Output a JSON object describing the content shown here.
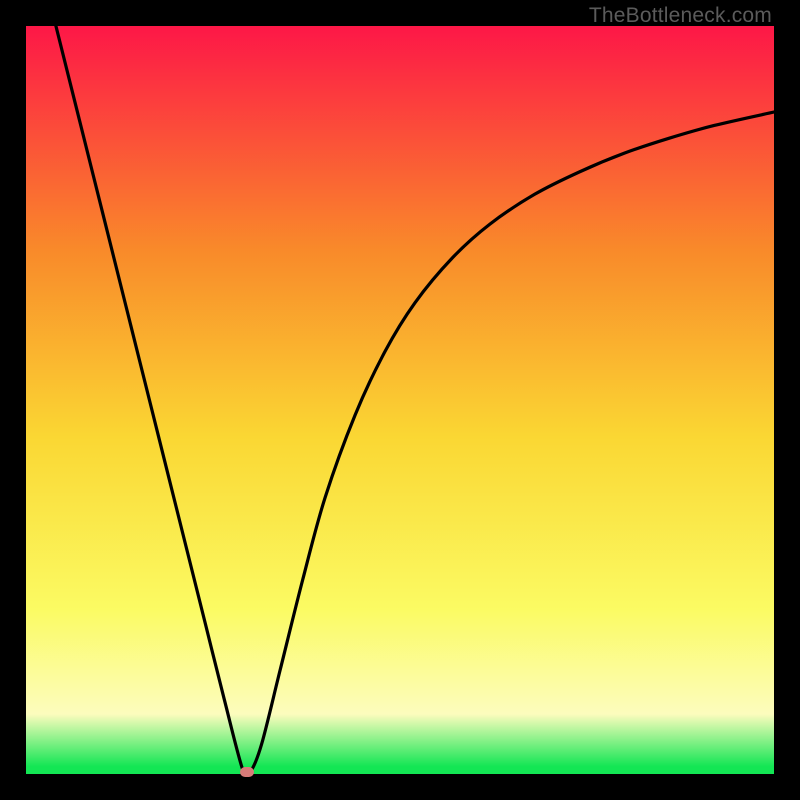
{
  "watermark": "TheBottleneck.com",
  "colors": {
    "gradient_top": "#fd1747",
    "gradient_upper_mid": "#f98a2a",
    "gradient_mid": "#fad733",
    "gradient_lower_mid": "#fbfb63",
    "gradient_lower": "#fcfcbd",
    "gradient_bottom": "#13e654",
    "curve": "#000000",
    "background": "#000000",
    "marker": "#d77b79"
  },
  "chart_data": {
    "type": "line",
    "title": "",
    "xlabel": "",
    "ylabel": "",
    "xlim": [
      0,
      100
    ],
    "ylim": [
      0,
      100
    ],
    "curve": {
      "points": [
        {
          "x": 4.0,
          "y": 100.0
        },
        {
          "x": 6.5,
          "y": 90.0
        },
        {
          "x": 9.0,
          "y": 80.0
        },
        {
          "x": 11.5,
          "y": 70.0
        },
        {
          "x": 14.0,
          "y": 60.0
        },
        {
          "x": 16.5,
          "y": 50.0
        },
        {
          "x": 19.0,
          "y": 40.0
        },
        {
          "x": 21.5,
          "y": 30.0
        },
        {
          "x": 24.0,
          "y": 20.0
        },
        {
          "x": 26.5,
          "y": 10.0
        },
        {
          "x": 29.0,
          "y": 0.5
        },
        {
          "x": 30.0,
          "y": 0.3
        },
        {
          "x": 31.5,
          "y": 4.0
        },
        {
          "x": 34.0,
          "y": 14.0
        },
        {
          "x": 37.0,
          "y": 26.0
        },
        {
          "x": 40.0,
          "y": 37.0
        },
        {
          "x": 44.0,
          "y": 48.0
        },
        {
          "x": 48.0,
          "y": 56.5
        },
        {
          "x": 52.0,
          "y": 63.0
        },
        {
          "x": 57.0,
          "y": 69.0
        },
        {
          "x": 62.0,
          "y": 73.5
        },
        {
          "x": 68.0,
          "y": 77.5
        },
        {
          "x": 74.0,
          "y": 80.5
        },
        {
          "x": 80.0,
          "y": 83.0
        },
        {
          "x": 86.0,
          "y": 85.0
        },
        {
          "x": 92.0,
          "y": 86.7
        },
        {
          "x": 100.0,
          "y": 88.5
        }
      ]
    },
    "marker": {
      "x": 29.5,
      "y": 0.3
    }
  }
}
